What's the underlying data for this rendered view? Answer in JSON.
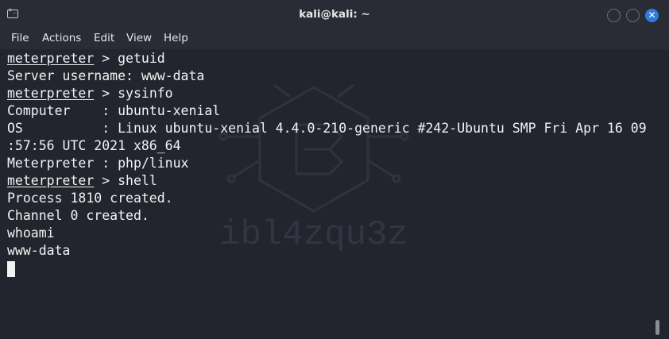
{
  "window": {
    "title": "kali@kali: ~",
    "close_glyph": "✕"
  },
  "menu": {
    "items": [
      "File",
      "Actions",
      "Edit",
      "View",
      "Help"
    ]
  },
  "terminal": {
    "prompt": "meterpreter",
    "watermark_text": "ibl4zqu3z",
    "lines": [
      {
        "prompt": "meterpreter",
        "rest": " > getuid"
      },
      {
        "text": "Server username: www-data"
      },
      {
        "prompt": "meterpreter",
        "rest": " > sysinfo"
      },
      {
        "text": "Computer    : ubuntu-xenial"
      },
      {
        "text": "OS          : Linux ubuntu-xenial 4.4.0-210-generic #242-Ubuntu SMP Fri Apr 16 09"
      },
      {
        "text": ":57:56 UTC 2021 x86_64"
      },
      {
        "text": "Meterpreter : php/linux"
      },
      {
        "prompt": "meterpreter",
        "rest": " > shell"
      },
      {
        "text": "Process 1810 created."
      },
      {
        "text": "Channel 0 created."
      },
      {
        "text": "whoami"
      },
      {
        "text": "www-data"
      }
    ]
  },
  "colors": {
    "background": "#23252e",
    "titlebar": "#2a2c35",
    "text": "#f2f2f2",
    "close_button": "#2f7be0"
  }
}
